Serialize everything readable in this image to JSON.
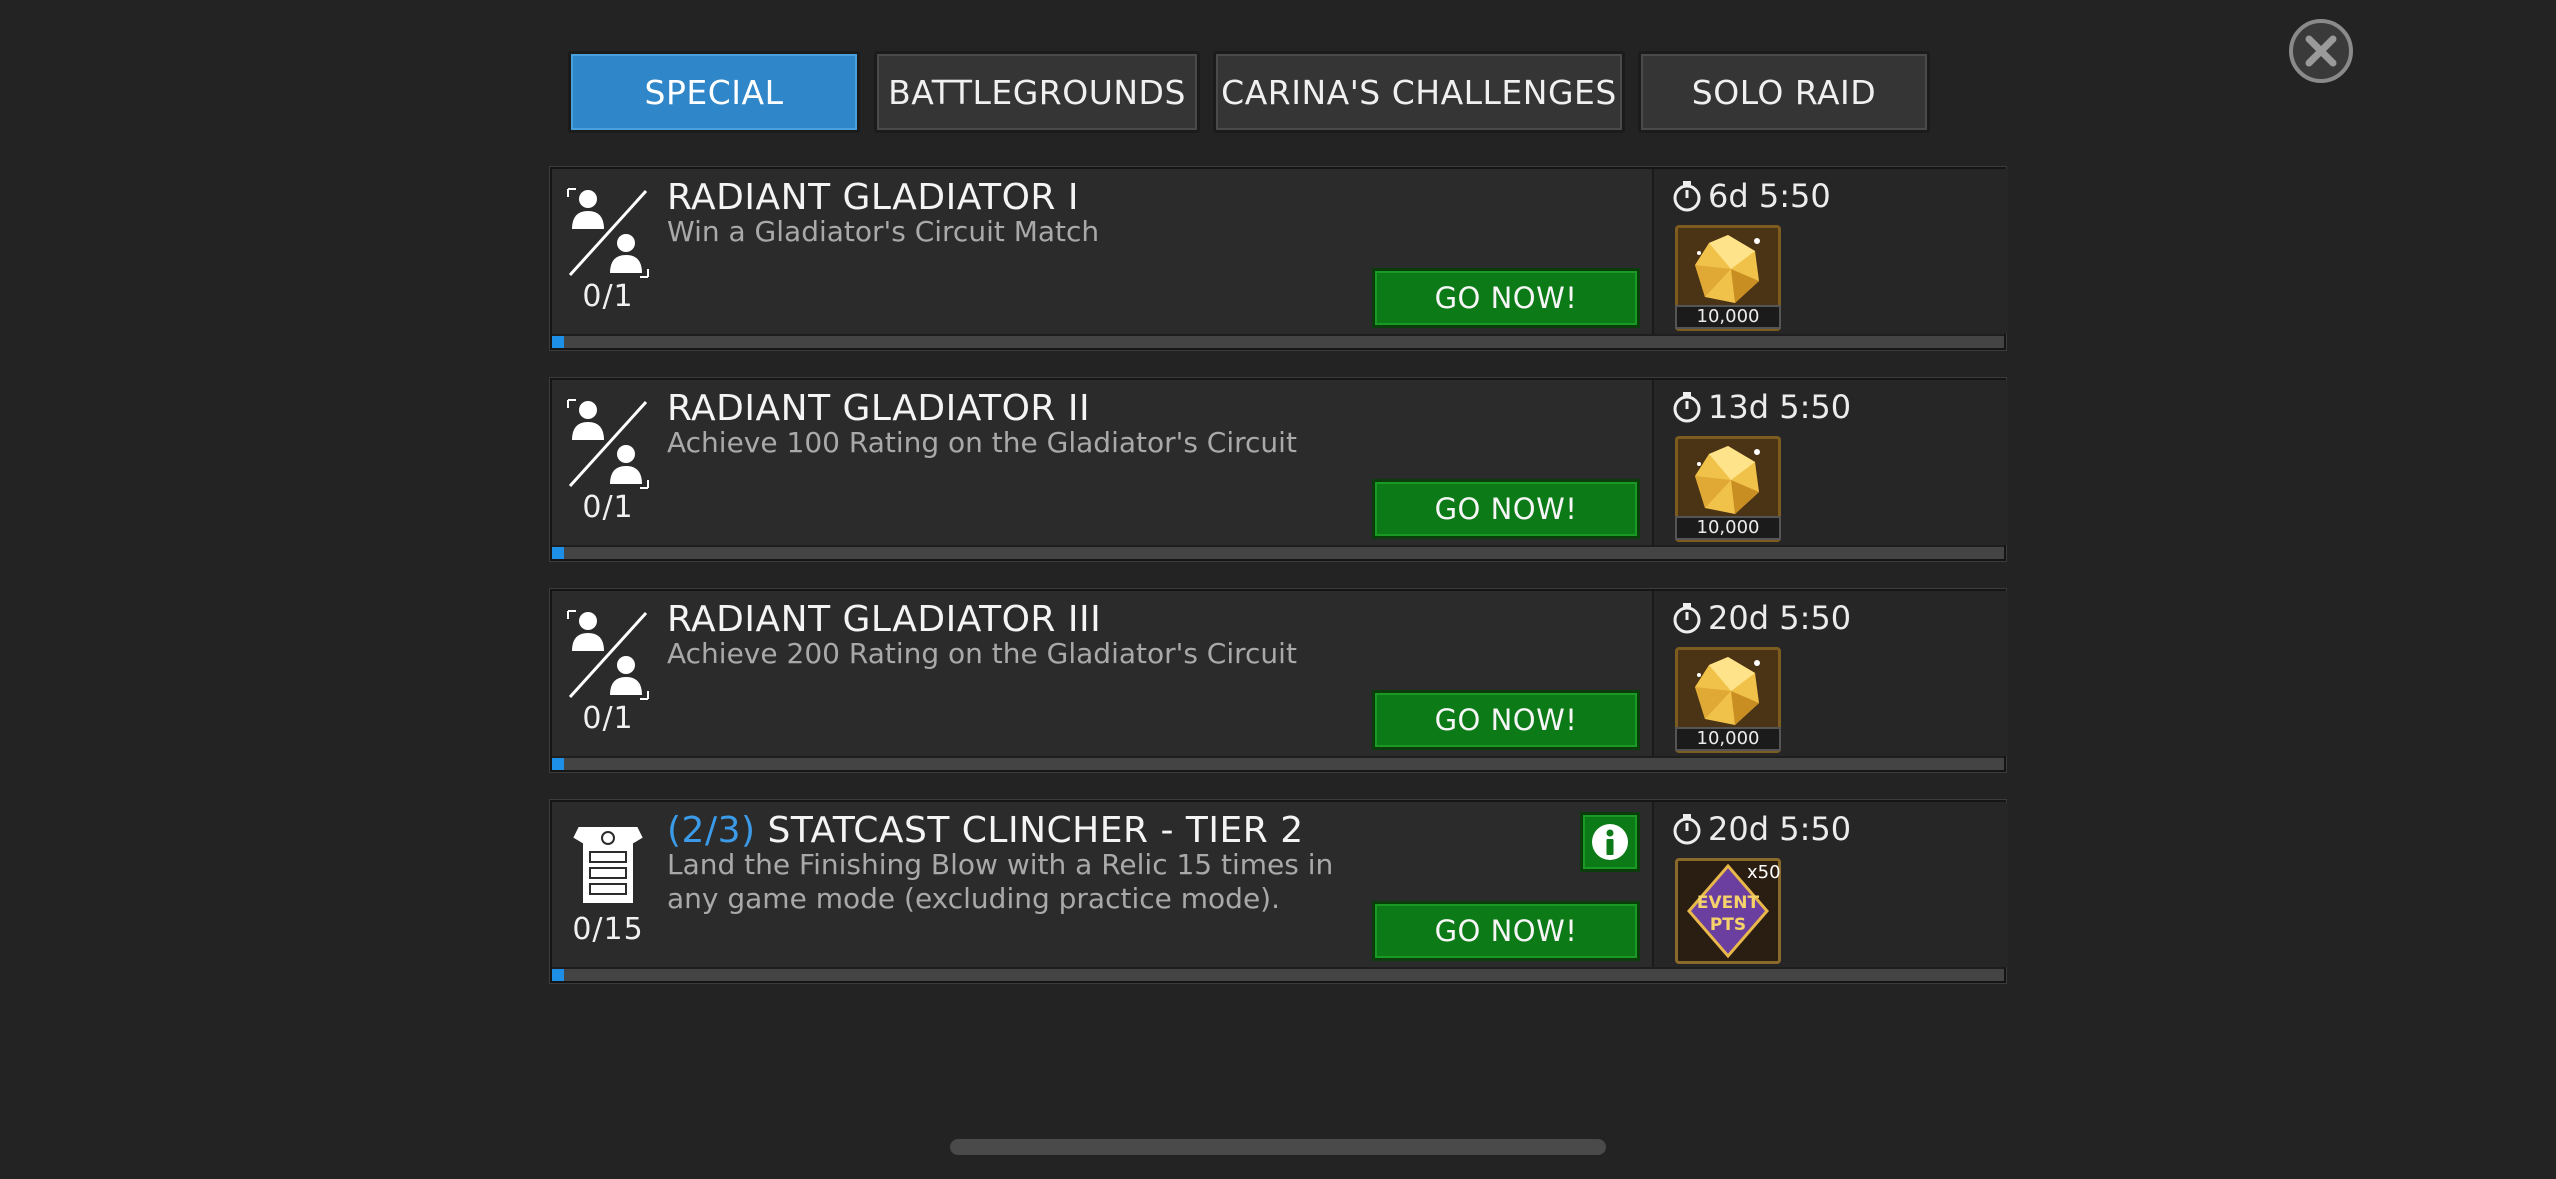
{
  "tabs": [
    {
      "label": "SPECIAL",
      "active": true
    },
    {
      "label": "BATTLEGROUNDS",
      "active": false
    },
    {
      "label": "CARINA'S CHALLENGES",
      "active": false
    },
    {
      "label": "SOLO RAID",
      "active": false
    }
  ],
  "close_icon": "close-icon",
  "go_label": "GO NOW!",
  "objectives": [
    {
      "title": "RADIANT GLADIATOR I",
      "description": "Win a Gladiator's Circuit Match",
      "progress": "0/1",
      "progress_fraction": 0,
      "timer": "6d 5:50",
      "reward_icon": "gold-crystal-icon",
      "reward_amount": "10,000"
    },
    {
      "title": "RADIANT GLADIATOR II",
      "description": "Achieve 100 Rating on the Gladiator's Circuit",
      "progress": "0/1",
      "progress_fraction": 0,
      "timer": "13d 5:50",
      "reward_icon": "gold-crystal-icon",
      "reward_amount": "10,000"
    },
    {
      "title": "RADIANT GLADIATOR III",
      "description": "Achieve 200 Rating on the Gladiator's Circuit",
      "progress": "0/1",
      "progress_fraction": 0,
      "timer": "20d 5:50",
      "reward_icon": "gold-crystal-icon",
      "reward_amount": "10,000"
    },
    {
      "tier": "(2/3)",
      "title": "STATCAST CLINCHER - TIER 2",
      "description": "Land the Finishing Blow with a Relic 15 times in any game mode (excluding practice mode).",
      "progress": "0/15",
      "progress_fraction": 0,
      "timer": "20d 5:50",
      "reward_icon": "event-points-icon",
      "reward_text": "EVENT PTS",
      "reward_multiplier": "x50"
    }
  ],
  "colors": {
    "accent_blue": "#2f86c8",
    "go_green": "#0c7a16",
    "progress_blue": "#1d8fe6"
  }
}
